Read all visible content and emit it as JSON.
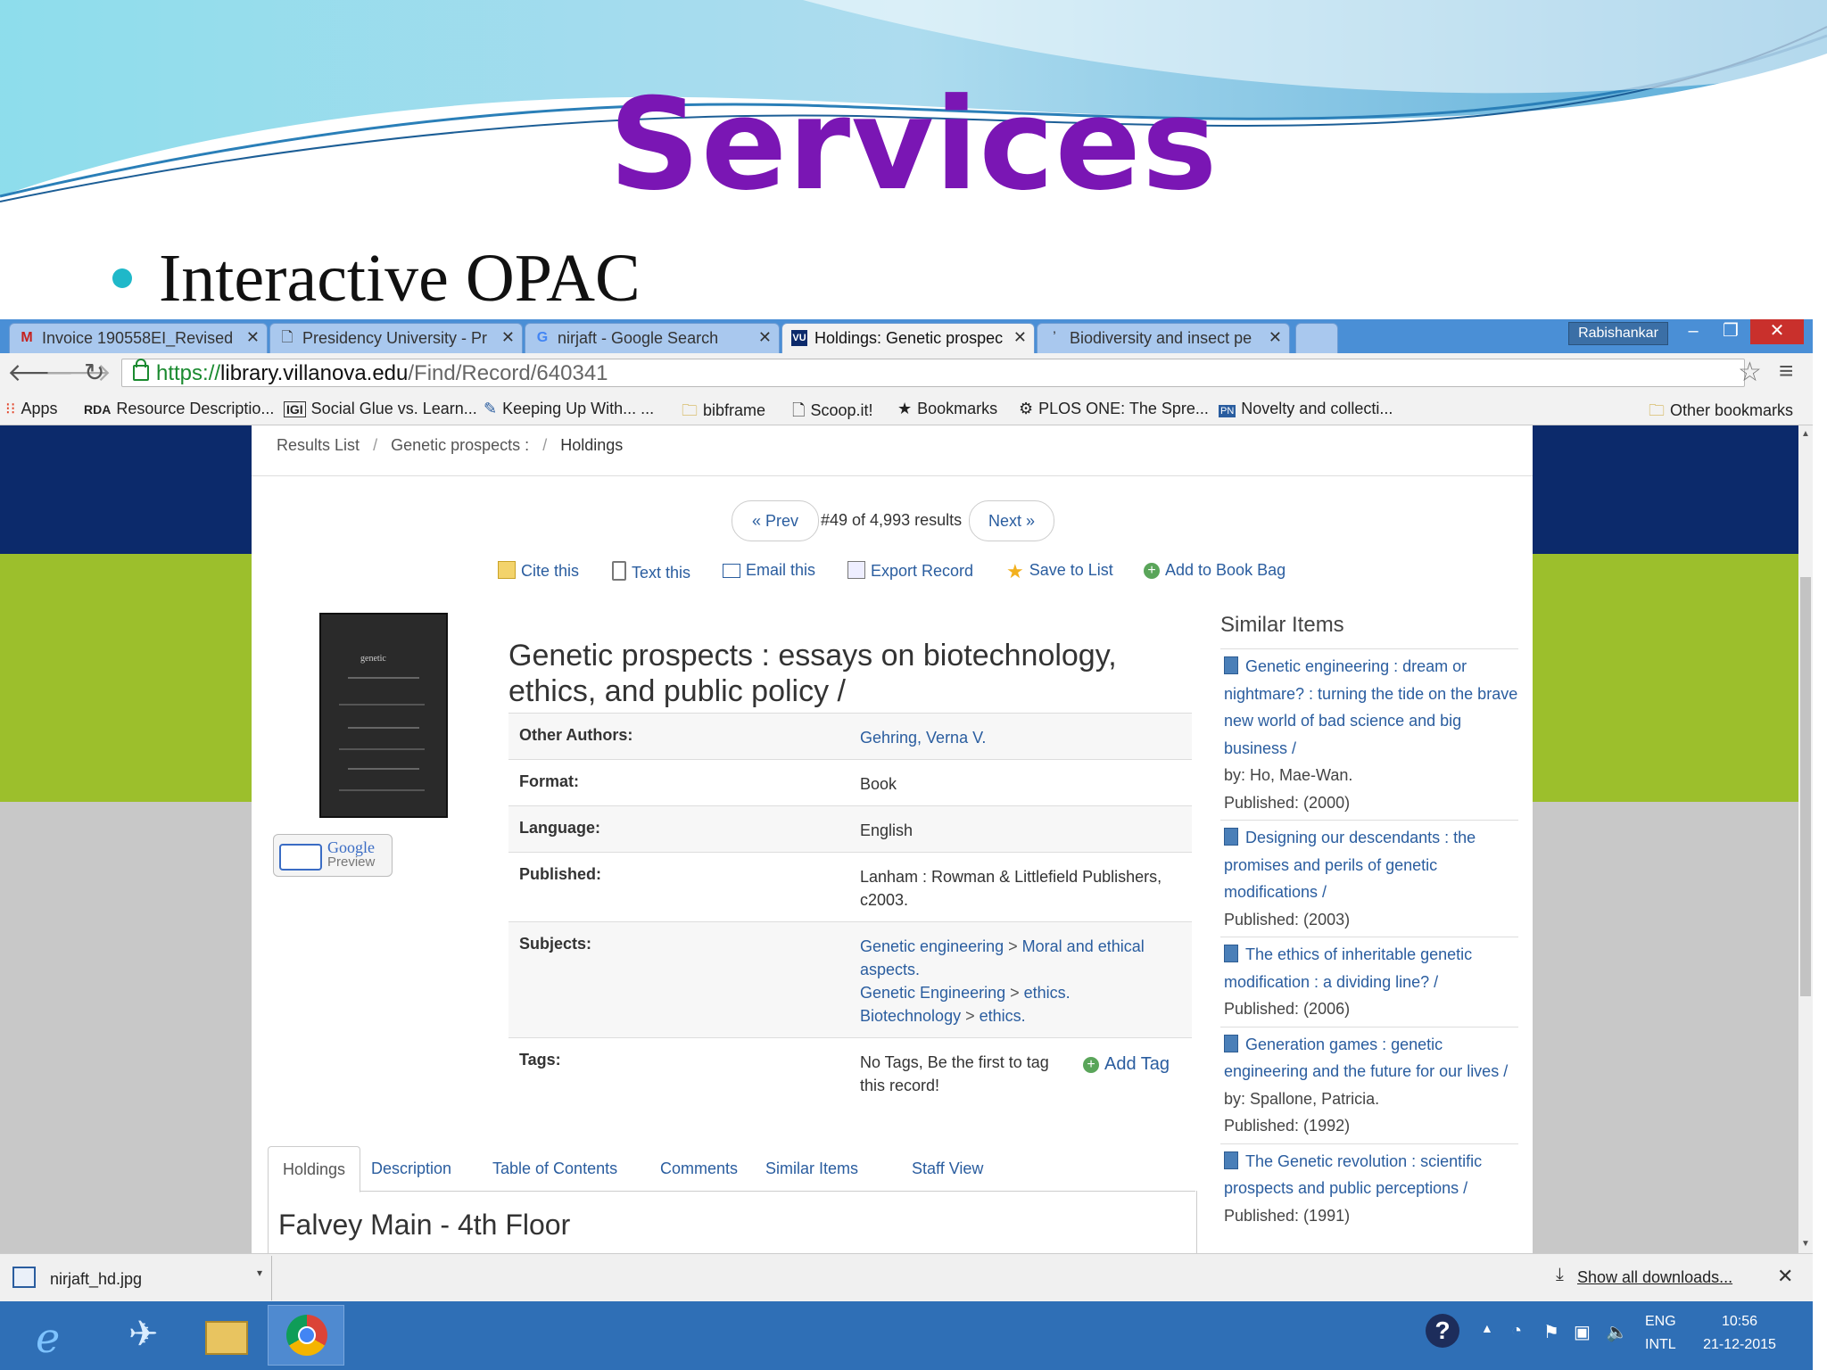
{
  "slide": {
    "title": "Services",
    "bullet": "Interactive OPAC"
  },
  "browser": {
    "tabs": [
      {
        "label": "Invoice 190558EI_Revised",
        "icon": "gmail-icon"
      },
      {
        "label": "Presidency University - Pr",
        "icon": "page-icon"
      },
      {
        "label": "nirjaft - Google Search",
        "icon": "google-icon"
      },
      {
        "label": "Holdings: Genetic prospec",
        "icon": "vu-icon"
      },
      {
        "label": "Biodiversity and insect pe",
        "icon": "page-icon"
      }
    ],
    "profile": "Rabishankar",
    "url_scheme": "https://",
    "url_host": "library.villanova.edu",
    "url_path": "/Find/Record/640341",
    "bookmarks": [
      {
        "label": "Apps",
        "icon": "apps-icon"
      },
      {
        "label": "Resource Descriptio...",
        "icon": "rda-icon"
      },
      {
        "label": "Social Glue vs. Learn...",
        "icon": "igi-icon"
      },
      {
        "label": "Keeping Up With... ...",
        "icon": "feather-icon"
      },
      {
        "label": "bibframe",
        "icon": "folder-icon"
      },
      {
        "label": "Scoop.it!",
        "icon": "page-icon"
      },
      {
        "label": "Bookmarks",
        "icon": "star-icon"
      },
      {
        "label": "PLOS ONE: The Spre...",
        "icon": "gear-icon"
      },
      {
        "label": "Novelty and collecti...",
        "icon": "pnas-icon"
      },
      {
        "label": "Other bookmarks",
        "icon": "folder-icon"
      }
    ],
    "icon_glyphs": {
      "rda": "RDA",
      "igi": "IGI",
      "pnas": "PN"
    }
  },
  "opac": {
    "breadcrumb": [
      "Results List",
      "Genetic prospects :",
      "Holdings"
    ],
    "prev": "« Prev",
    "result_count": "#49 of 4,993 results",
    "next": "Next »",
    "tools": [
      "Cite this",
      "Text this",
      "Email this",
      "Export Record",
      "Save to List",
      "Add to Book Bag"
    ],
    "google_preview": [
      "Google",
      "Preview"
    ],
    "title": "Genetic prospects : essays on biotechnology, ethics, and public policy /",
    "details": {
      "other_authors_label": "Other Authors:",
      "other_authors": "Gehring, Verna V.",
      "format_label": "Format:",
      "format": "Book",
      "language_label": "Language:",
      "language": "English",
      "published_label": "Published:",
      "published": "Lanham : Rowman & Littlefield Publishers, c2003.",
      "subjects_label": "Subjects:",
      "subjects": [
        [
          "Genetic engineering",
          "Moral and ethical aspects."
        ],
        [
          "Genetic Engineering",
          "ethics."
        ],
        [
          "Biotechnology",
          "ethics."
        ]
      ],
      "tags_label": "Tags:",
      "tags_text": "No Tags, Be the first to tag this record!",
      "add_tag": "Add Tag"
    },
    "record_tabs": [
      "Holdings",
      "Description",
      "Table of Contents",
      "Comments",
      "Similar Items",
      "Staff View"
    ],
    "location": "Falvey Main - 4th Floor",
    "similar_heading": "Similar Items",
    "similar": [
      {
        "title": "Genetic engineering : dream or nightmare? : turning the tide on the brave new world of bad science and big business /",
        "by": "by: Ho, Mae-Wan.",
        "published": "Published: (2000)"
      },
      {
        "title": "Designing our descendants : the promises and perils of genetic modifications /",
        "by": "",
        "published": "Published: (2003)"
      },
      {
        "title": "The ethics of inheritable genetic modification : a dividing line? /",
        "by": "",
        "published": "Published: (2006)"
      },
      {
        "title": "Generation games : genetic engineering and the future for our lives /",
        "by": "by: Spallone, Patricia.",
        "published": "Published: (1992)"
      },
      {
        "title": "The Genetic revolution : scientific prospects and public perceptions /",
        "by": "",
        "published": "Published: (1991)"
      }
    ]
  },
  "downloads": {
    "file": "nirjaft_hd.jpg",
    "show_all": "Show all downloads..."
  },
  "taskbar": {
    "lang_1": "ENG",
    "lang_2": "INTL",
    "time": "10:56",
    "date": "21-12-2015"
  },
  "colors": {
    "title_purple": "#7a16b4",
    "navy_band": "#0c2a6b",
    "green_band": "#9cbf2c",
    "link_blue": "#2a5d9f",
    "taskbar_blue": "#2f6fb6"
  }
}
